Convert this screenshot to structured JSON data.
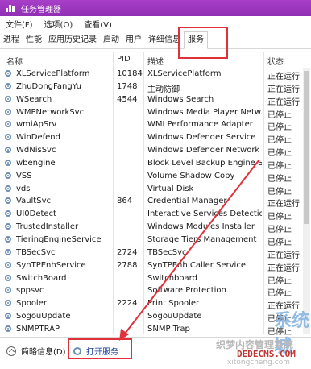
{
  "window": {
    "title": "任务管理器"
  },
  "menu": [
    "文件(F)",
    "选项(O)",
    "查看(V)"
  ],
  "tabs": [
    {
      "label": "进程",
      "active": false
    },
    {
      "label": "性能",
      "active": false
    },
    {
      "label": "应用历史记录",
      "active": false
    },
    {
      "label": "启动",
      "active": false
    },
    {
      "label": "用户",
      "active": false
    },
    {
      "label": "详细信息",
      "active": false
    },
    {
      "label": "服务",
      "active": true
    }
  ],
  "columns": {
    "name": "名称",
    "pid": "PID",
    "desc": "描述",
    "status": "状态"
  },
  "services": [
    {
      "name": "XLServicePlatform",
      "pid": "10184",
      "desc": "XLServicePlatform",
      "status": "正在运行"
    },
    {
      "name": "ZhuDongFangYu",
      "pid": "1748",
      "desc": "主动防御",
      "status": "正在运行"
    },
    {
      "name": "WSearch",
      "pid": "4544",
      "desc": "Windows Search",
      "status": "正在运行"
    },
    {
      "name": "WMPNetworkSvc",
      "pid": "",
      "desc": "Windows Media Player Netw...",
      "status": "已停止"
    },
    {
      "name": "wmiApSrv",
      "pid": "",
      "desc": "WMI Performance Adapter",
      "status": "已停止"
    },
    {
      "name": "WinDefend",
      "pid": "",
      "desc": "Windows Defender Service",
      "status": "已停止"
    },
    {
      "name": "WdNisSvc",
      "pid": "",
      "desc": "Windows Defender Network I...",
      "status": "已停止"
    },
    {
      "name": "wbengine",
      "pid": "",
      "desc": "Block Level Backup Engine Se...",
      "status": "已停止"
    },
    {
      "name": "VSS",
      "pid": "",
      "desc": "Volume Shadow Copy",
      "status": "已停止"
    },
    {
      "name": "vds",
      "pid": "",
      "desc": "Virtual Disk",
      "status": "已停止"
    },
    {
      "name": "VaultSvc",
      "pid": "864",
      "desc": "Credential Manager",
      "status": "正在运行"
    },
    {
      "name": "UI0Detect",
      "pid": "",
      "desc": "Interactive Services Detection",
      "status": "已停止"
    },
    {
      "name": "TrustedInstaller",
      "pid": "",
      "desc": "Windows Modules Installer",
      "status": "已停止"
    },
    {
      "name": "TieringEngineService",
      "pid": "",
      "desc": "Storage Tiers Management",
      "status": "已停止"
    },
    {
      "name": "TBSecSvc",
      "pid": "2724",
      "desc": "TBSecSvc",
      "status": "正在运行"
    },
    {
      "name": "SynTPEnhService",
      "pid": "2788",
      "desc": "SynTPEnh Caller Service",
      "status": "正在运行"
    },
    {
      "name": "SwitchBoard",
      "pid": "",
      "desc": "Switchboard",
      "status": "已停止"
    },
    {
      "name": "sppsvc",
      "pid": "",
      "desc": "Software Protection",
      "status": "已停止"
    },
    {
      "name": "Spooler",
      "pid": "2224",
      "desc": "Print Spooler",
      "status": "正在运行"
    },
    {
      "name": "SogouUpdate",
      "pid": "",
      "desc": "SogouUpdate",
      "status": "已停止"
    },
    {
      "name": "SNMPTRAP",
      "pid": "",
      "desc": "SNMP Trap",
      "status": "已停止"
    }
  ],
  "footer": {
    "fewer_details": "简略信息(D)",
    "open_services": "打开服务"
  },
  "watermark": {
    "logo": "系统城",
    "text": "织梦内容管理系统",
    "url": "DEDECMS.COM",
    "small": "xitongcheng.com"
  },
  "colors": {
    "titlebar": "#9b36c0",
    "highlight": "#e0313b",
    "icon": "#6c8fb6"
  }
}
